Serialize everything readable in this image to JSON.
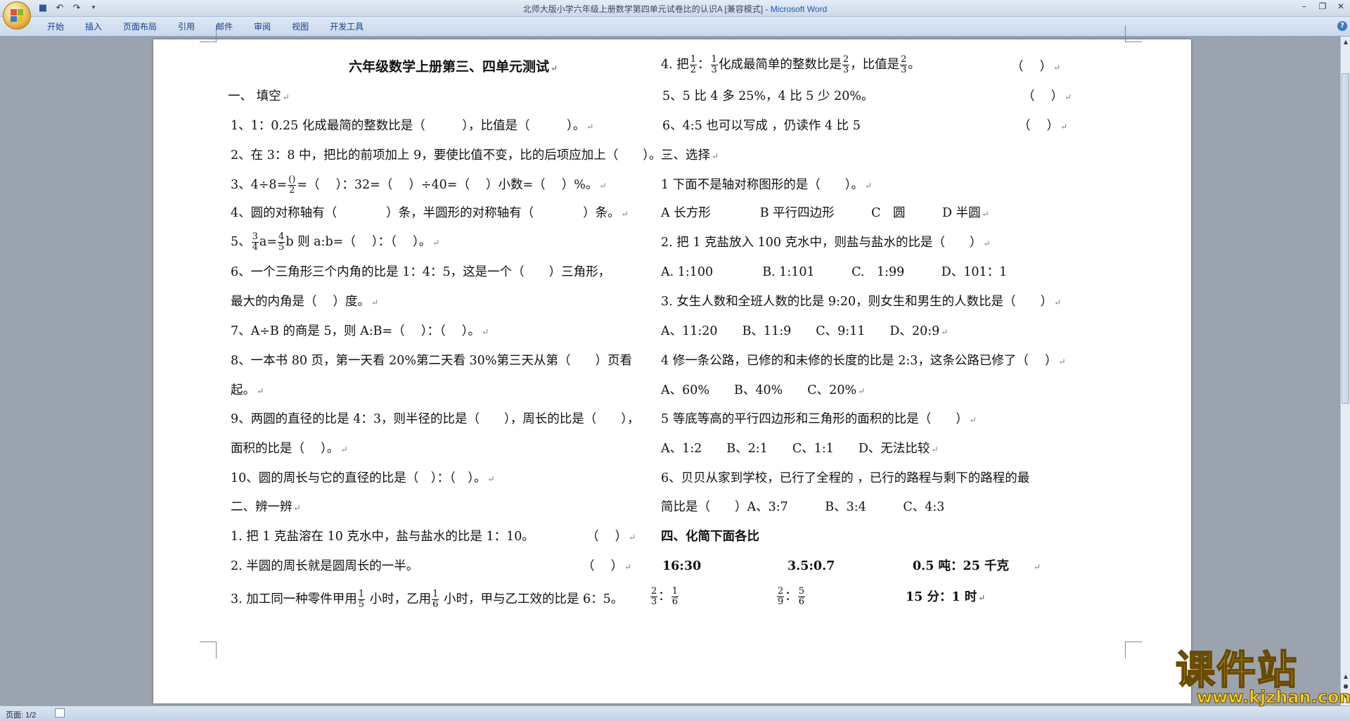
{
  "window": {
    "title": "北师大版小学六年级上册数学第四单元试卷比的认识A [兼容模式]",
    "app_name": "Microsoft Word",
    "title_sep": " - "
  },
  "ribbon": {
    "tabs": [
      "开始",
      "插入",
      "页面布局",
      "引用",
      "邮件",
      "审阅",
      "视图",
      "开发工具"
    ]
  },
  "status": {
    "page": "页面: 1/2"
  },
  "watermark": {
    "big": "课件站",
    "url": "www.kjzhan.com"
  },
  "doc": {
    "title": "六年级数学上册第三、四单元测试",
    "s1": "一、 填空",
    "q1": "1、1：0.25 化成最简的整数比是（　　　），比值是（　　　）。",
    "q2": "2、在 3：8 中，把比的前项加上 9，要使比值不变，比的后项应加上（　　）。",
    "q3a": "3、4÷8=",
    "q3_num": "()",
    "q3_den": "2",
    "q3b": "=（　 ）：32=（　 ）÷40=（　 ）小数=（　 ）%。",
    "q4": "4、圆的对称轴有（　　　　）条，半圆形的对称轴有（　　　　）条。",
    "q5a": "5、",
    "q5_f1n": "3",
    "q5_f1d": "4",
    "q5b": "a=",
    "q5_f2n": "4",
    "q5_f2d": "5",
    "q5c": "b 则 a:b=（　 ）：（　 ）。",
    "q6a": "6、一个三角形三个内角的比是 1：4：5，这是一个（　　）三角形，",
    "q6b": "最大的内角是（　 ）度。",
    "q7": "7、A÷B 的商是 5，则 A:B=（　 ）：（　 ）。",
    "q8a": "8、一本书 80 页，第一天看 20%第二天看 30%第三天从第（　　）页看",
    "q8b": "起。",
    "q9a": "9、两圆的直径的比是 4：3，则半径的比是（　　），周长的比是（　　），",
    "q9b": "面积的比是（　 ）。",
    "q10": "10、圆的周长与它的直径的比是（　）：（　）。",
    "s2": "二、辨一辨",
    "j1": "1. 把 1 克盐溶在 10 克水中，盐与盐水的比是 1：10。",
    "j2": "2. 半圆的周长就是圆周长的一半。",
    "j3a": "3. 加工同一种零件甲用",
    "j3_f1n": "1",
    "j3_f1d": "5",
    "j3b": " 小时，乙用",
    "j3_f2n": "1",
    "j3_f2d": "6",
    "j3c": " 小时，甲与乙工效的比是 6：5。",
    "j4a": "4. 把",
    "j4_f1n": "1",
    "j4_f1d": "2",
    "j4_colon": "：",
    "j4_f2n": "1",
    "j4_f2d": "3",
    "j4b": "化成最简单的整数比是",
    "j4_f3n": "2",
    "j4_f3d": "3",
    "j4c": "，比值是",
    "j4_f4n": "2",
    "j4_f4d": "3",
    "j4d": "。",
    "j5": "5、5 比 4 多 25%，4 比 5 少 20%。",
    "j6": "6、4:5 也可以写成 ，仍读作 4 比 5",
    "paren": "（　 ）",
    "s3": "三、选择",
    "c1": "1 下面不是轴对称图形的是（　　）。",
    "c1o": "A 长方形　　　　B 平行四边形　　　C　圆　　　D 半圆",
    "c2": "2. 把 1 克盐放入 100 克水中，则盐与盐水的比是（　　）",
    "c2o": "A. 1:100　　　　B. 1:101　　　C.　1:99　　　D、101：1",
    "c3": "3. 女生人数和全班人数的比是 9:20，则女生和男生的人数比是（　　）",
    "c3o": "A、11:20　　B、11:9　　C、9:11　　D、20:9",
    "c4": "4 修一条公路，已修的和未修的长度的比是 2:3，这条公路已修了（　 ）",
    "c4o": "A、60%　　B、40%　　C、20%",
    "c5": "5 等底等高的平行四边形和三角形的面积的比是（　　）",
    "c5o": "A、1:2　　B、2:1　　C、1:1　　D、无法比较",
    "c6a": "6、贝贝从家到学校，已行了全程的 ，已行的路程与剩下的路程的最",
    "c6b": "简比是（　　）A、3:7　　　B、3:4　　　C、4:3",
    "s4": "四、化简下面各比",
    "r1": "16:30",
    "r2": "3.5:0.7",
    "r3": "0.5 吨：25 千克",
    "r4_f1n": "2",
    "r4_f1d": "3",
    "r4_f2n": "1",
    "r4_f2d": "6",
    "r5_f1n": "2",
    "r5_f1d": "9",
    "r5_f2n": "5",
    "r5_f2d": "6",
    "r_colon": "：",
    "r6": "15 分：1 时",
    "mark": "↵"
  }
}
